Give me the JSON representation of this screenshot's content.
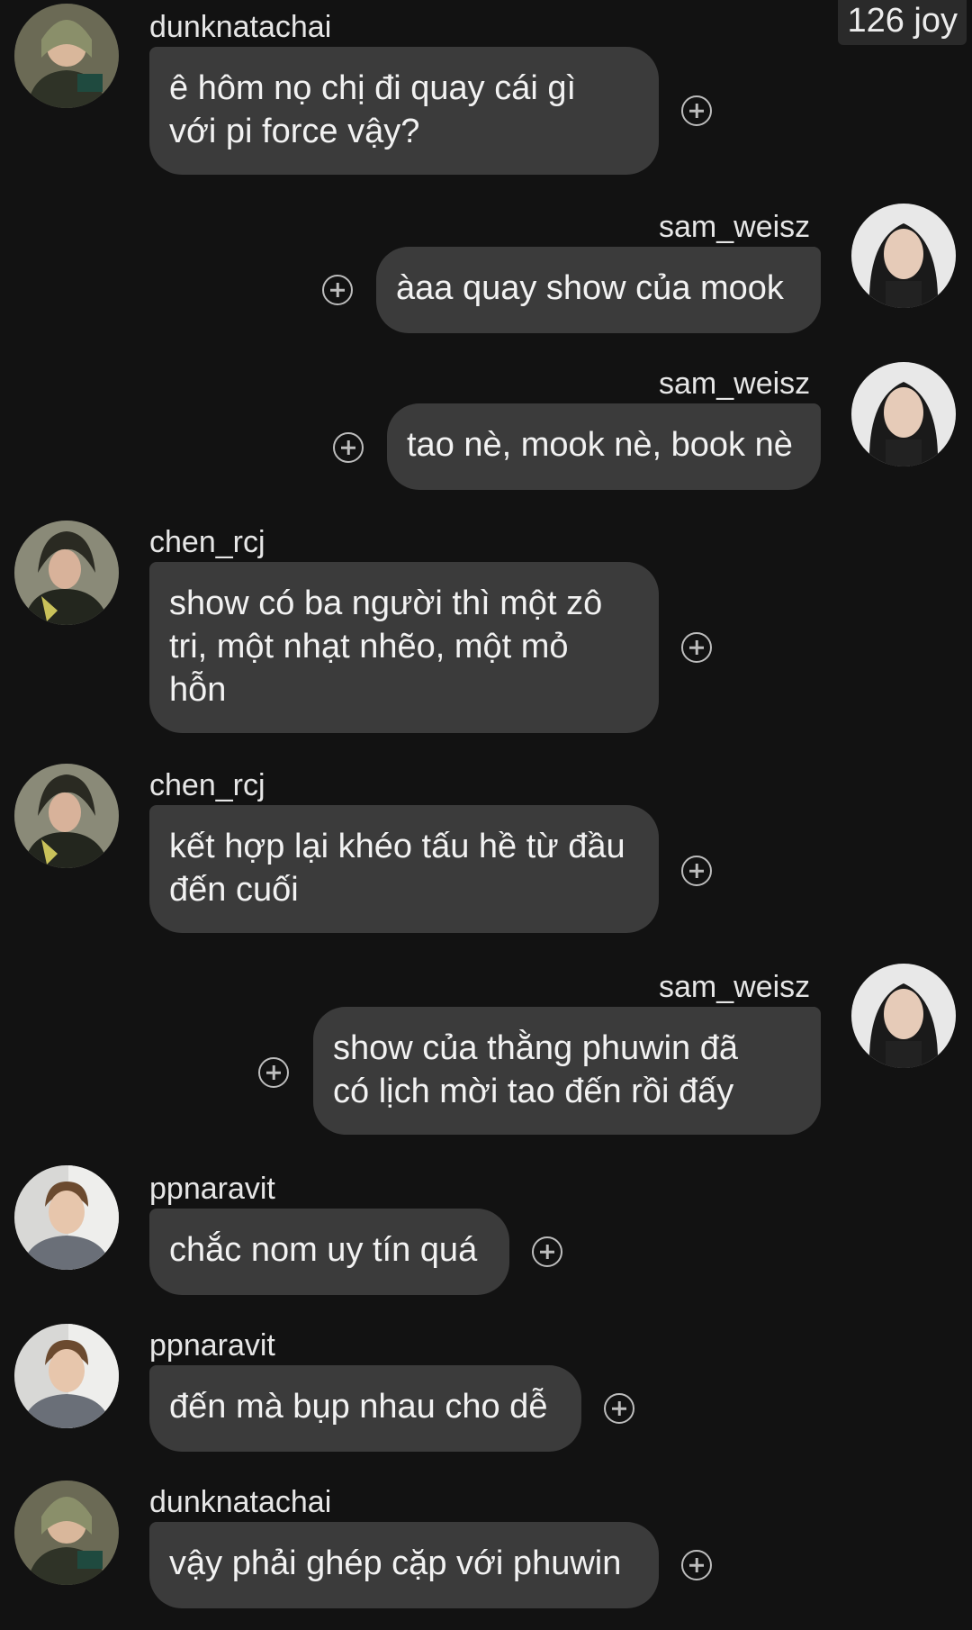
{
  "badge": {
    "text": "126 joy"
  },
  "colors": {
    "background": "#121212",
    "bubble": "#3b3b3b",
    "text": "#f2f2f2",
    "reaction_icon": "#bdbdbd"
  },
  "messages": [
    {
      "user": "dunknatachai",
      "side": "left",
      "lines": [
        "ê hôm nọ chị đi quay cái gì",
        "với pi force vậy?"
      ]
    },
    {
      "user": "sam_weisz",
      "side": "right",
      "lines": [
        "àaa quay show của mook"
      ]
    },
    {
      "user": "sam_weisz",
      "side": "right",
      "lines": [
        "tao nè, mook nè, book nè"
      ]
    },
    {
      "user": "chen_rcj",
      "side": "left",
      "lines": [
        "show có ba người thì một zô",
        "tri, một nhạt nhẽo, một mỏ",
        "hỗn"
      ]
    },
    {
      "user": "chen_rcj",
      "side": "left",
      "lines": [
        "kết hợp lại khéo tấu hề từ đầu",
        "đến cuối"
      ]
    },
    {
      "user": "sam_weisz",
      "side": "right",
      "lines": [
        "show của thằng phuwin đã",
        "có lịch mời tao đến rồi đấy"
      ]
    },
    {
      "user": "ppnaravit",
      "side": "left",
      "lines": [
        "chắc nom uy tín quá"
      ]
    },
    {
      "user": "ppnaravit",
      "side": "left",
      "lines": [
        "đến mà bụp nhau cho dễ"
      ]
    },
    {
      "user": "dunknatachai",
      "side": "left",
      "lines": [
        "vậy phải ghép cặp với phuwin"
      ]
    }
  ]
}
